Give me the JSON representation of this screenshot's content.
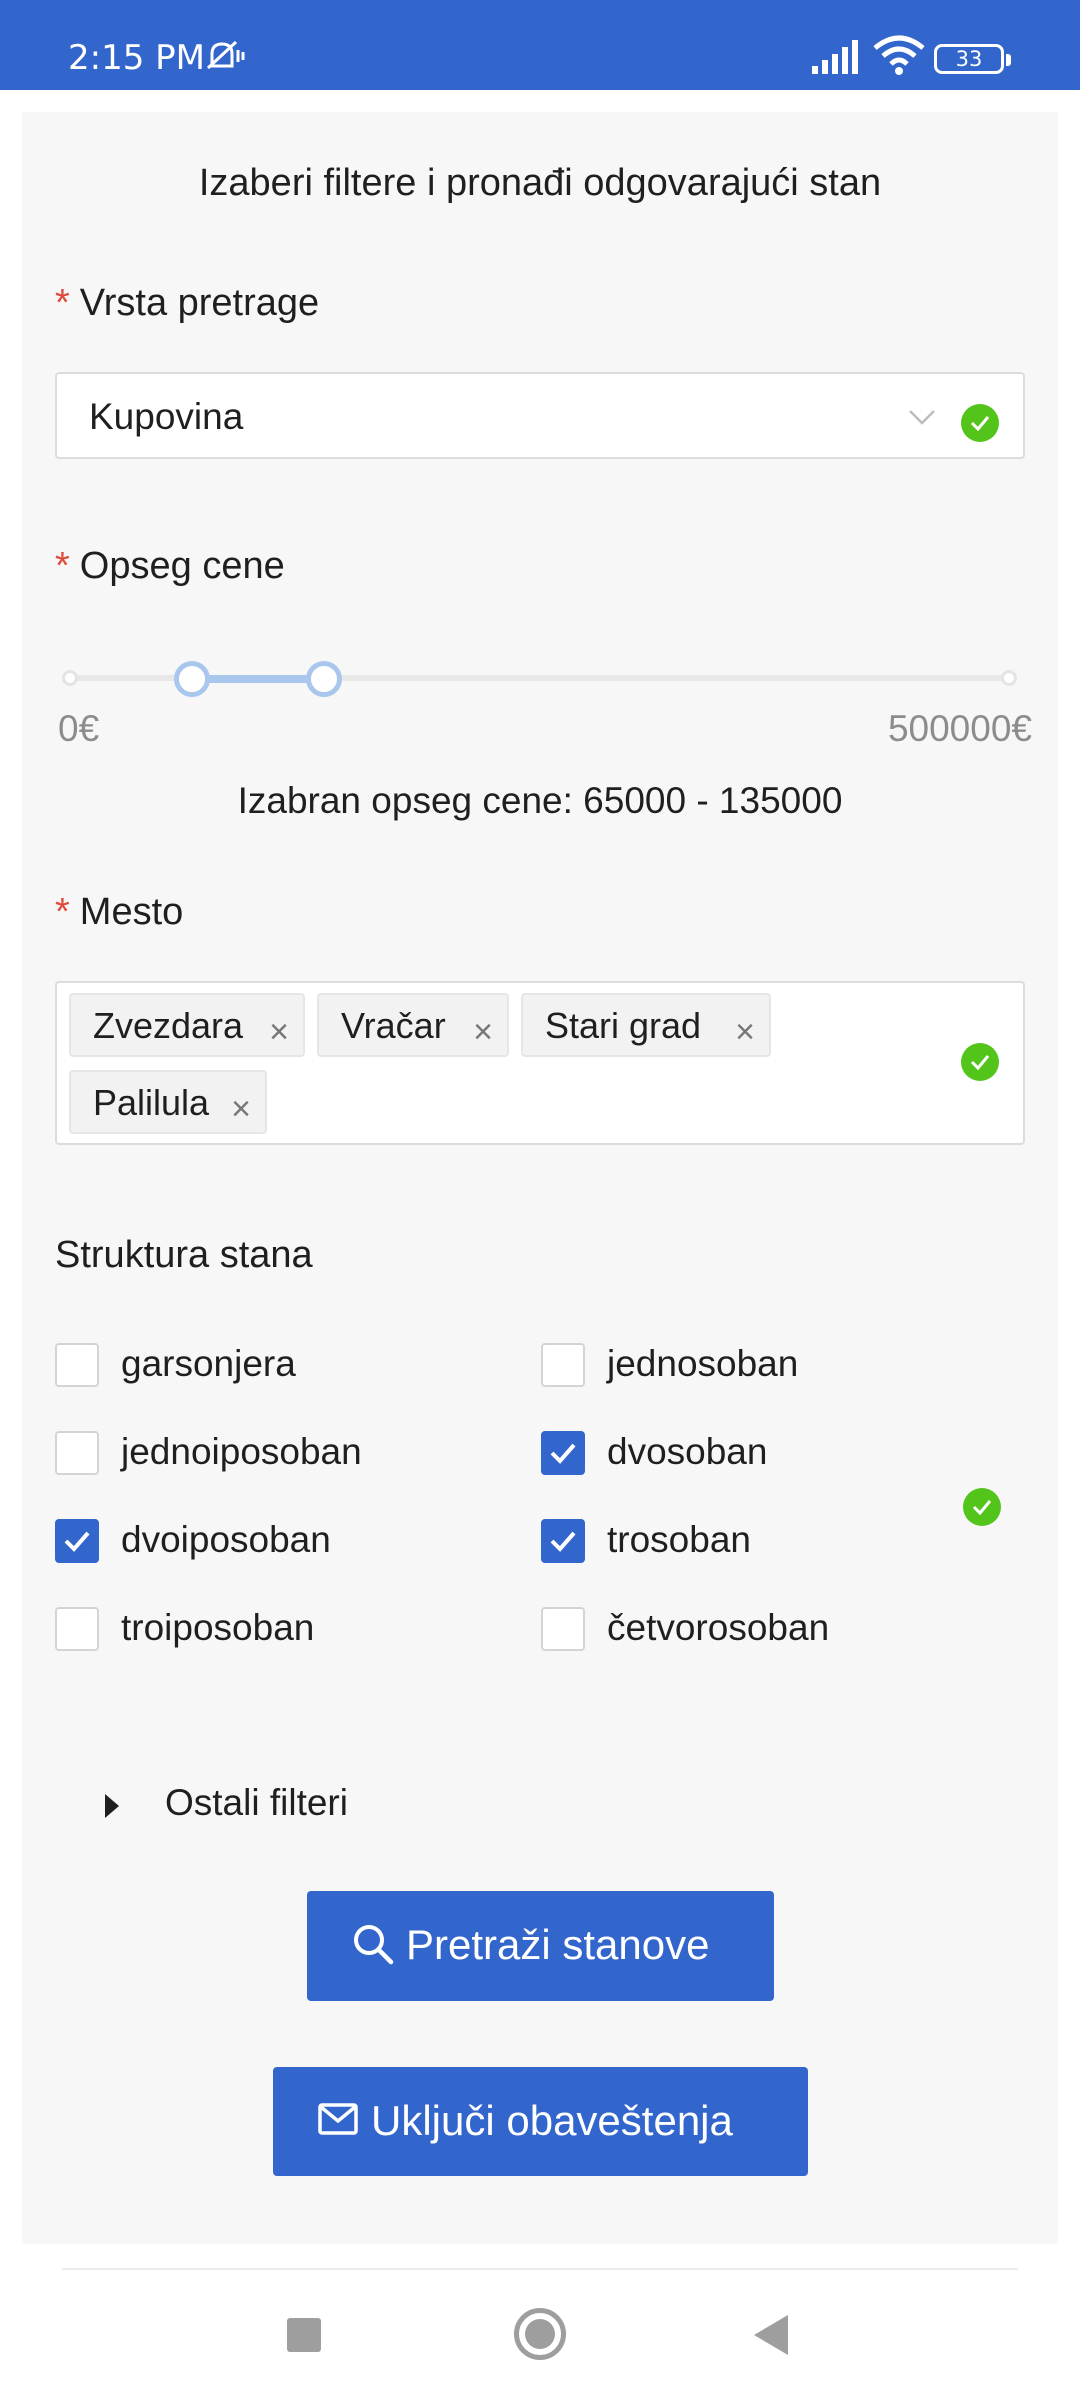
{
  "status_bar": {
    "time": "2:15 PM",
    "battery": "33"
  },
  "intro_text": "Izaberi filtere i pronađi odgovarajući stan",
  "required_mark": "*",
  "search_type": {
    "label": "Vrsta pretrage",
    "value": "Kupovina"
  },
  "price": {
    "label": "Opseg cene",
    "min_label": "0€",
    "max_label": "500000€",
    "min": 0,
    "max": 500000,
    "selected_low": 65000,
    "selected_high": 135000,
    "summary": "Izabran opseg cene: 65000 - 135000"
  },
  "location": {
    "label": "Mesto",
    "tags": [
      "Zvezdara",
      "Vračar",
      "Stari grad",
      "Palilula"
    ],
    "remove_glyph": "×"
  },
  "structure": {
    "label": "Struktura stana",
    "options": [
      {
        "label": "garsonjera",
        "checked": false
      },
      {
        "label": "jednosoban",
        "checked": false
      },
      {
        "label": "jednoiposoban",
        "checked": false
      },
      {
        "label": "dvosoban",
        "checked": true
      },
      {
        "label": "dvoiposoban",
        "checked": true
      },
      {
        "label": "trosoban",
        "checked": true
      },
      {
        "label": "troiposoban",
        "checked": false
      },
      {
        "label": "četvorosoban",
        "checked": false
      }
    ]
  },
  "more_filters_label": "Ostali filteri",
  "search_button": {
    "label": "Pretraži stanove",
    "icon": "search-icon"
  },
  "notify_button": {
    "label": "Uključi obaveštenja",
    "icon": "mail-icon"
  },
  "colors": {
    "primary": "#3366cc",
    "success": "#52c41a",
    "required": "#e04a3c",
    "slider": "#a9c7ec"
  }
}
